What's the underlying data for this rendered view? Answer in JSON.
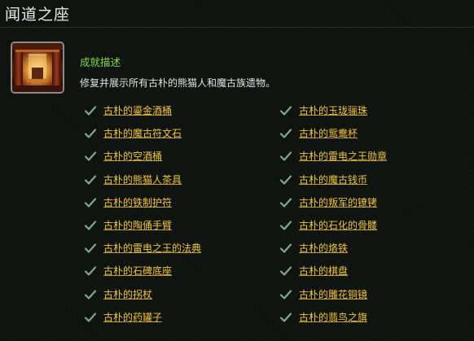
{
  "page": {
    "title": "闻道之座"
  },
  "icon": {
    "name": "achievement-icon"
  },
  "description": {
    "heading": "成就描述",
    "text": "修复并展示所有古朴的熊猫人和魔古族遗物。"
  },
  "criteria": {
    "left": [
      "古朴的鎏金酒桶",
      "古朴的魔古符文石",
      "古朴的空酒桶",
      "古朴的熊猫人茶具",
      "古朴的铁制护符",
      "古朴的陶俑手臂",
      "古朴的雷电之王的法典",
      "古朴的石碑底座",
      "古朴的拐杖",
      "古朴的药罐子"
    ],
    "right": [
      "古朴的玉珑骊珠",
      "古朴的鸳鸯杯",
      "古朴的雷电之王勋章",
      "古朴的魔古钱币",
      "古朴的叛军的镣铐",
      "古朴的石化的骨髅",
      "古朴的烙铁",
      "古朴的棋盘",
      "古朴的雕花铜镜",
      "古朴的翡鸟之旗"
    ],
    "completed": true
  },
  "colors": {
    "background": "#0f1310",
    "heading_green": "#83d94a",
    "link_gold": "#f0c43c",
    "check_green": "#7fa890"
  }
}
